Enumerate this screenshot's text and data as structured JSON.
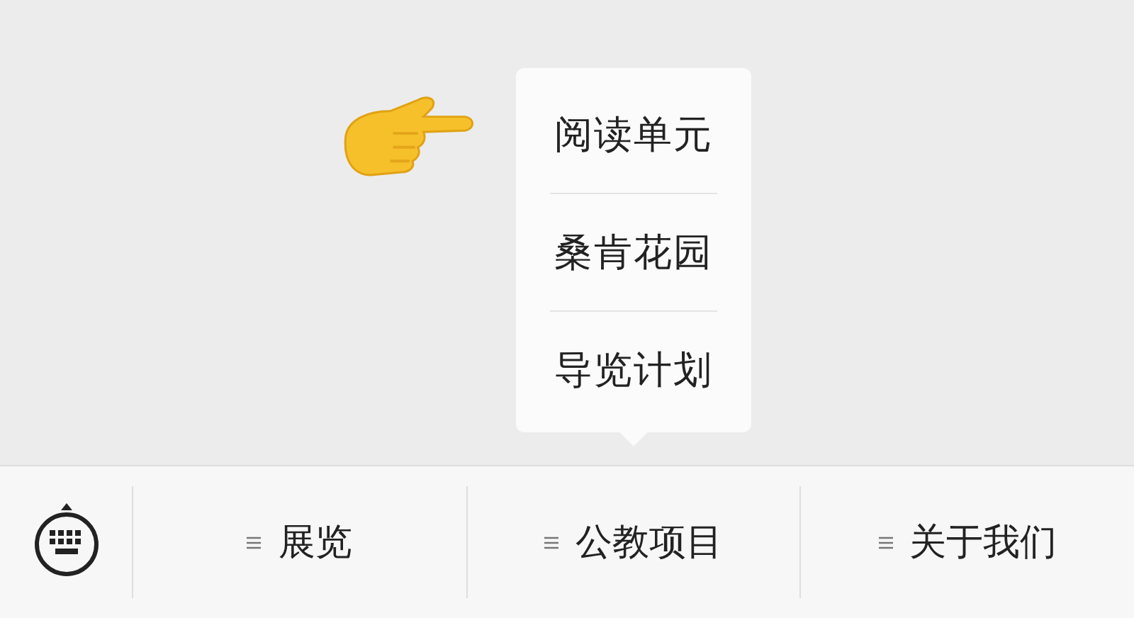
{
  "bottom_menu": {
    "items": [
      {
        "label": "展览"
      },
      {
        "label": "公教项目",
        "submenu": [
          "阅读单元",
          "桑肯花园",
          "导览计划"
        ]
      },
      {
        "label": "关于我们"
      }
    ]
  }
}
